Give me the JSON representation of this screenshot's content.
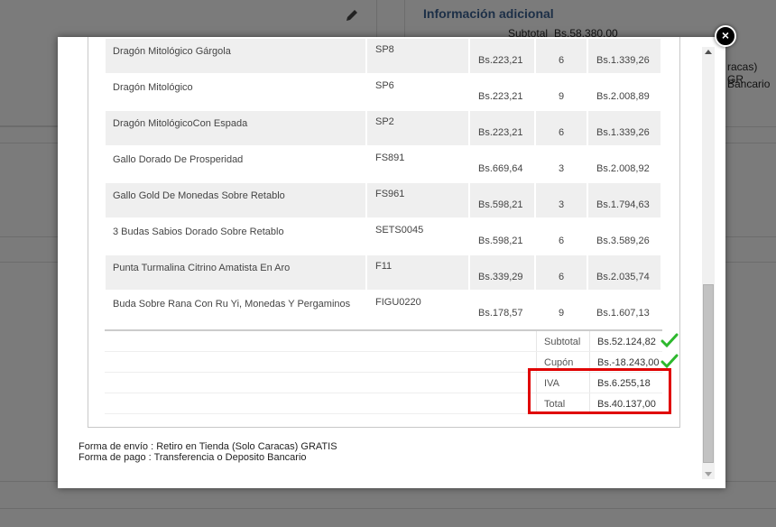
{
  "background": {
    "section_title": "Información adicional",
    "subtotal_label": "Subtotal",
    "subtotal_value": "Bs.58.380,00",
    "side_text_1": "racas) GR",
    "side_text_2": "Bancario"
  },
  "modal": {
    "close_label": "×",
    "items": [
      {
        "name": "Dragón Mitológico Gárgola",
        "code": "SP8",
        "price": "Bs.223,21",
        "qty": "6",
        "total": "Bs.1.339,26"
      },
      {
        "name": "Dragón Mitológico",
        "code": "SP6",
        "price": "Bs.223,21",
        "qty": "9",
        "total": "Bs.2.008,89"
      },
      {
        "name": "Dragón MitológicoCon Espada",
        "code": "SP2",
        "price": "Bs.223,21",
        "qty": "6",
        "total": "Bs.1.339,26"
      },
      {
        "name": "Gallo Dorado De Prosperidad",
        "code": "FS891",
        "price": "Bs.669,64",
        "qty": "3",
        "total": "Bs.2.008,92"
      },
      {
        "name": "Gallo Gold De Monedas Sobre Retablo",
        "code": "FS961",
        "price": "Bs.598,21",
        "qty": "3",
        "total": "Bs.1.794,63"
      },
      {
        "name": "3 Budas Sabios Dorado Sobre Retablo",
        "code": "SETS0045",
        "price": "Bs.598,21",
        "qty": "6",
        "total": "Bs.3.589,26"
      },
      {
        "name": "Punta Turmalina Citrino Amatista En Aro",
        "code": "F11",
        "price": "Bs.339,29",
        "qty": "6",
        "total": "Bs.2.035,74"
      },
      {
        "name": "Buda Sobre Rana Con Ru Yi, Monedas Y Pergaminos",
        "code": "FIGU0220",
        "price": "Bs.178,57",
        "qty": "9",
        "total": "Bs.1.607,13"
      }
    ],
    "totals": {
      "subtotal_label": "Subtotal",
      "subtotal_value": "Bs.52.124,82",
      "coupon_label": "Cupón",
      "coupon_value": "Bs.-18.243,00",
      "iva_label": "IVA",
      "iva_value": "Bs.6.255,18",
      "total_label": "Total",
      "total_value": "Bs.40.137,00"
    },
    "shipping_text": "Forma de envío : Retiro en Tienda (Solo Caracas) GRATIS",
    "payment_text": "Forma de pago : Transferencia o Deposito Bancario"
  },
  "colors": {
    "highlight": "#e00000",
    "check": "#2db82d",
    "title": "#1c2f47"
  }
}
